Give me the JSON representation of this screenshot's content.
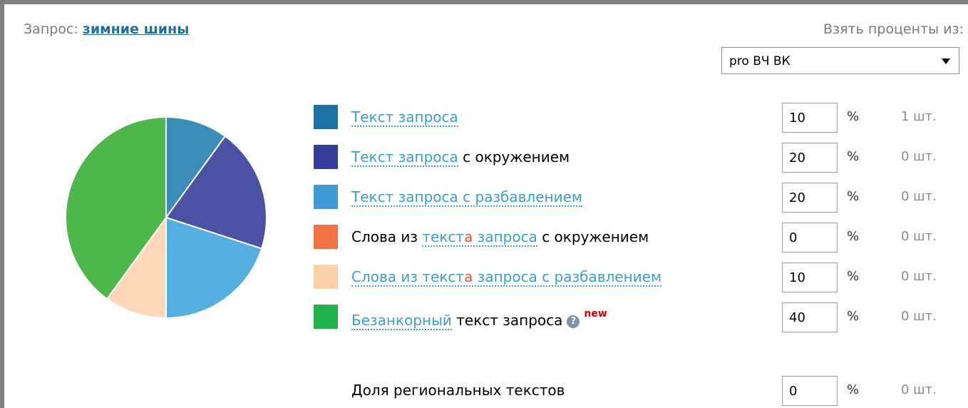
{
  "query": {
    "label": "Запрос:",
    "value": "зимние шины"
  },
  "percent_source": {
    "label": "Взять проценты из:",
    "selected": "pro ВЧ ВК"
  },
  "rows": [
    {
      "color": "#1b72a2",
      "pie_color": "#3b8db8",
      "percent": "10",
      "percent_sign": "%",
      "count": "1 шт.",
      "parts": {
        "link": "Текст запроса"
      }
    },
    {
      "color": "#343d99",
      "pie_color": "#4b52a4",
      "percent": "20",
      "percent_sign": "%",
      "count": "0 шт.",
      "parts": {
        "link": "Текст запроса",
        "rest": " с окружением"
      }
    },
    {
      "color": "#3f9ad6",
      "pie_color": "#54aee0",
      "percent": "20",
      "percent_sign": "%",
      "count": "0 шт.",
      "parts": {
        "link": "Текст запроса с разбавлением"
      }
    },
    {
      "color": "#f07245",
      "pie_color": "#f07245",
      "percent": "0",
      "percent_sign": "%",
      "count": "0 шт.",
      "parts": {
        "prefix": "Слова из ",
        "link_a": "текст",
        "red": "а",
        "link_b": " запроса",
        "rest": " с окружением"
      }
    },
    {
      "color": "#fcd1a8",
      "pie_color": "#fcd8b8",
      "percent": "10",
      "percent_sign": "%",
      "count": "0 шт.",
      "parts": {
        "link_a": "Слова из текст",
        "red": "а",
        "link_b": " запроса с разбавлением"
      }
    },
    {
      "color": "#22b048",
      "pie_color": "#4db849",
      "percent": "40",
      "percent_sign": "%",
      "count": "0 шт.",
      "parts": {
        "link": "Безанкорный",
        "rest": " текст запроса",
        "help": "?",
        "badge": "new"
      }
    }
  ],
  "regional": {
    "label": "Доля региональных текстов",
    "percent": "0",
    "percent_sign": "%",
    "count": "0 шт."
  },
  "chart_data": {
    "type": "pie",
    "title": "",
    "slices": [
      {
        "value": 10,
        "color": "#3b8db8"
      },
      {
        "value": 20,
        "color": "#4b52a4"
      },
      {
        "value": 20,
        "color": "#54aee0"
      },
      {
        "value": 0,
        "color": "#f07245"
      },
      {
        "value": 10,
        "color": "#fcd8b8"
      },
      {
        "value": 40,
        "color": "#4db849"
      }
    ]
  }
}
